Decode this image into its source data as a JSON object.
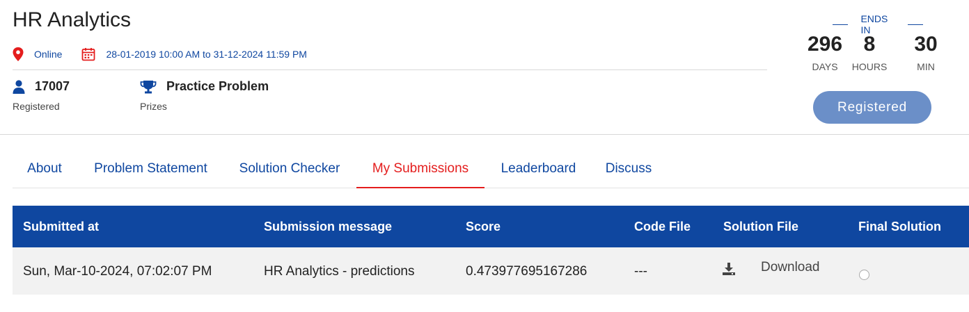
{
  "contest": {
    "title": "HR Analytics",
    "location": "Online",
    "dates": "28-01-2019 10:00 AM to 31-12-2024 11:59 PM",
    "registered_count": "17007",
    "registered_label": "Registered",
    "prize_value": "Practice Problem",
    "prize_label": "Prizes"
  },
  "countdown": {
    "label": "ENDS IN",
    "days": "296",
    "days_label": "DAYS",
    "hours": "8",
    "hours_label": "HOURS",
    "mins": "30",
    "mins_label": "MIN"
  },
  "register_button": "Registered",
  "tabs": [
    {
      "label": "About"
    },
    {
      "label": "Problem Statement"
    },
    {
      "label": "Solution Checker"
    },
    {
      "label": "My Submissions",
      "active": true
    },
    {
      "label": "Leaderboard"
    },
    {
      "label": "Discuss"
    }
  ],
  "table": {
    "headers": [
      "Submitted at",
      "Submission message",
      "Score",
      "Code File",
      "Solution File",
      "Final Solution"
    ],
    "rows": [
      {
        "submitted_at": "Sun, Mar-10-2024, 07:02:07 PM",
        "message": "HR Analytics - predictions",
        "score": "0.473977695167286",
        "code_file": "---",
        "solution_file": "Download",
        "final_solution_selected": false
      }
    ]
  },
  "colors": {
    "primary": "#0f47a0",
    "active_tab": "#e41d1d",
    "button": "#6b8fc8",
    "row_bg": "#f2f2f2"
  },
  "icons": [
    "location-pin-icon",
    "calendar-icon",
    "user-icon",
    "trophy-icon",
    "download-icon",
    "radio-icon"
  ]
}
